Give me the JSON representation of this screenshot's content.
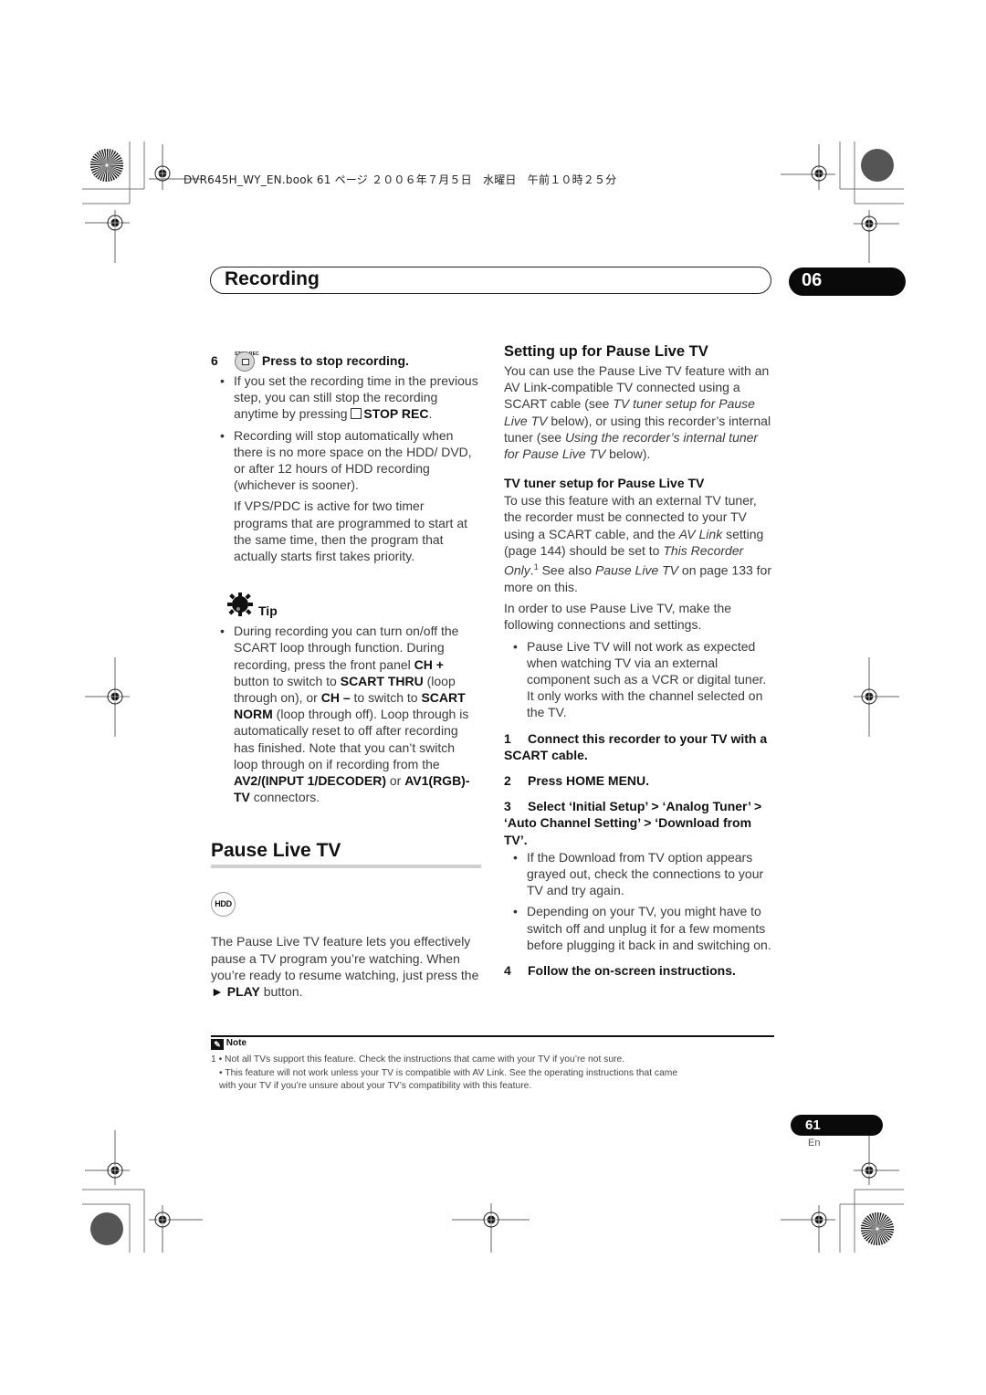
{
  "print_header": "DVR645H_WY_EN.book  61 ページ  ２００６年７月５日　水曜日　午前１０時２５分",
  "chapter": {
    "title": "Recording",
    "number": "06"
  },
  "left_column": {
    "step6": {
      "button_label": "STOP REC",
      "number": "6",
      "text": "Press to stop recording."
    },
    "bullet1": {
      "pre": "If you set the recording time in the previous step, you can still stop the recording anytime by pressing ",
      "bold": "STOP REC",
      "post": "."
    },
    "bullet2": "Recording will stop automatically when there is no more space on the HDD/ DVD, or after 12 hours of HDD recording (whichever is sooner).",
    "para_vps": "If VPS/PDC is active for two timer programs that are programmed to start at the same time, then the program that actually starts first takes priority.",
    "tip": {
      "label": "Tip",
      "t1": "During recording you can turn on/off the SCART loop through function. During recording, press the front panel ",
      "b1": "CH +",
      "t2": " button to switch to ",
      "b2": "SCART THRU",
      "t3": " (loop through on), or ",
      "b3": "CH –",
      "t4": " to switch to ",
      "b4": "SCART NORM",
      "t5": " (loop through off). Loop through is automatically reset to off after recording has finished. Note that you can’t switch loop through on if recording from the ",
      "b5": "AV2/(INPUT 1/DECODER)",
      "t6": " or ",
      "b6": "AV1(RGB)-TV",
      "t7": " connectors."
    },
    "pause_section": {
      "heading": "Pause Live TV",
      "badge": "HDD",
      "p_pre": "The Pause Live TV feature lets you effectively pause a TV program you’re watching. When you’re ready to resume watching, just press the ",
      "p_play": "► PLAY",
      "p_post": " button."
    }
  },
  "right_column": {
    "setup": {
      "heading": "Setting up for Pause Live TV",
      "t1": "You can use the Pause Live TV feature with an AV Link-compatible TV connected using a SCART cable (see ",
      "i1": "TV tuner setup for Pause Live TV",
      "t2": " below), or using this recorder’s internal tuner (see ",
      "i2": "Using the recorder’s internal tuner for Pause Live TV",
      "t3": " below)."
    },
    "tuner": {
      "heading": "TV tuner setup for Pause Live TV",
      "t1": "To use this feature with an external TV tuner, the recorder must be connected to your TV using a SCART cable, and the ",
      "i1": "AV Link",
      "t2": " setting (page 144) should be set to ",
      "i2": "This Recorder Only",
      "t3": ".",
      "sup": "1",
      "t4": " See also ",
      "i3": "Pause Live TV",
      "t5": " on page 133 for more on this.",
      "para2": "In order to use Pause Live TV, make the following connections and settings.",
      "bullet1": "Pause Live TV will not work as expected when watching TV via an external component such as a VCR or digital tuner. It only works with the channel selected on the TV."
    },
    "steps": [
      {
        "number": "1",
        "text": "Connect this recorder to your TV with a SCART cable."
      },
      {
        "number": "2",
        "text": "Press HOME MENU."
      },
      {
        "number": "3",
        "text": "Select ‘Initial Setup’ > ‘Analog Tuner’ > ‘Auto Channel Setting’ > ‘Download from TV’."
      },
      {
        "number": "4",
        "text": "Follow the on-screen instructions."
      }
    ],
    "step3_bullets": [
      "If the Download from TV option appears grayed out, check the connections to your TV and try again.",
      "Depending on your TV, you might have to switch off and unplug it for a few moments before plugging it back in and switching on."
    ]
  },
  "note": {
    "label": "Note",
    "line1": "1 • Not all TVs support this feature. Check the instructions that came with your TV if you’re not sure.",
    "line2": "• This feature will not work unless your TV is compatible with AV Link. See the operating instructions that came",
    "line3": "with your TV if you’re unsure about your TV’s compatibility with this feature."
  },
  "footer": {
    "page_number": "61",
    "language": "En"
  }
}
